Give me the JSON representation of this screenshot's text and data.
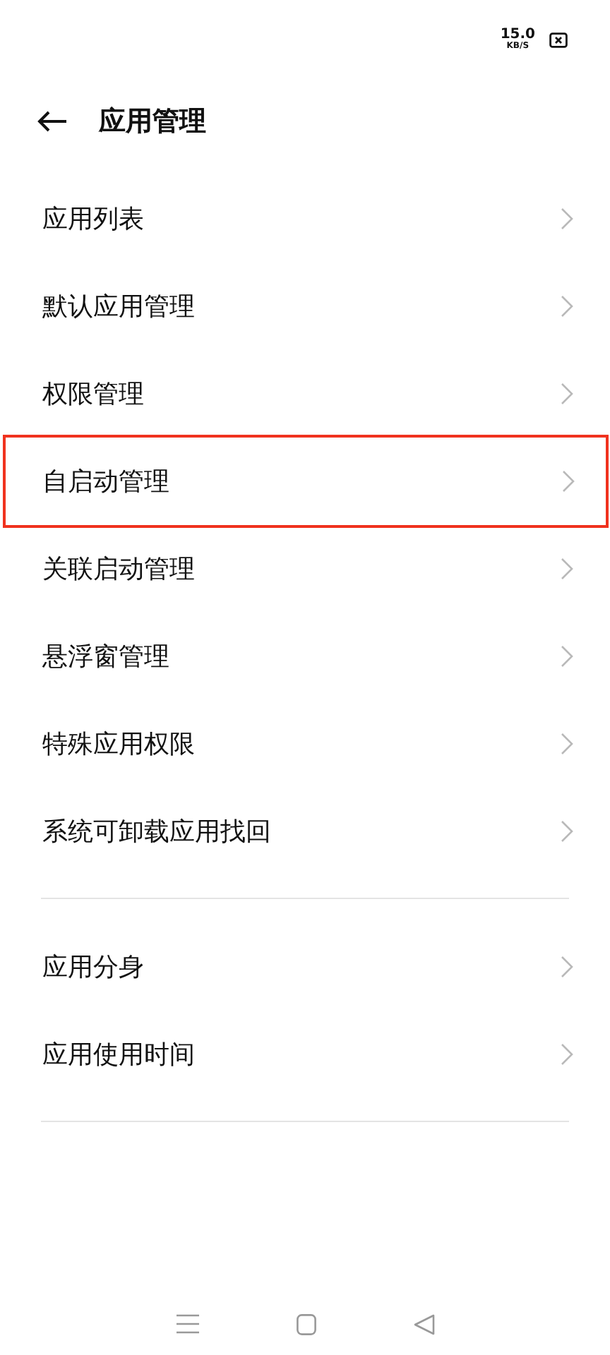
{
  "status_bar": {
    "net_speed": "15.0",
    "net_unit": "KB/S"
  },
  "header": {
    "title": "应用管理"
  },
  "groups": [
    {
      "items": [
        {
          "label": "应用列表",
          "highlighted": false
        },
        {
          "label": "默认应用管理",
          "highlighted": false
        },
        {
          "label": "权限管理",
          "highlighted": false
        },
        {
          "label": "自启动管理",
          "highlighted": true
        },
        {
          "label": "关联启动管理",
          "highlighted": false
        },
        {
          "label": "悬浮窗管理",
          "highlighted": false
        },
        {
          "label": "特殊应用权限",
          "highlighted": false
        },
        {
          "label": "系统可卸载应用找回",
          "highlighted": false
        }
      ]
    },
    {
      "items": [
        {
          "label": "应用分身",
          "highlighted": false
        },
        {
          "label": "应用使用时间",
          "highlighted": false
        }
      ]
    }
  ]
}
